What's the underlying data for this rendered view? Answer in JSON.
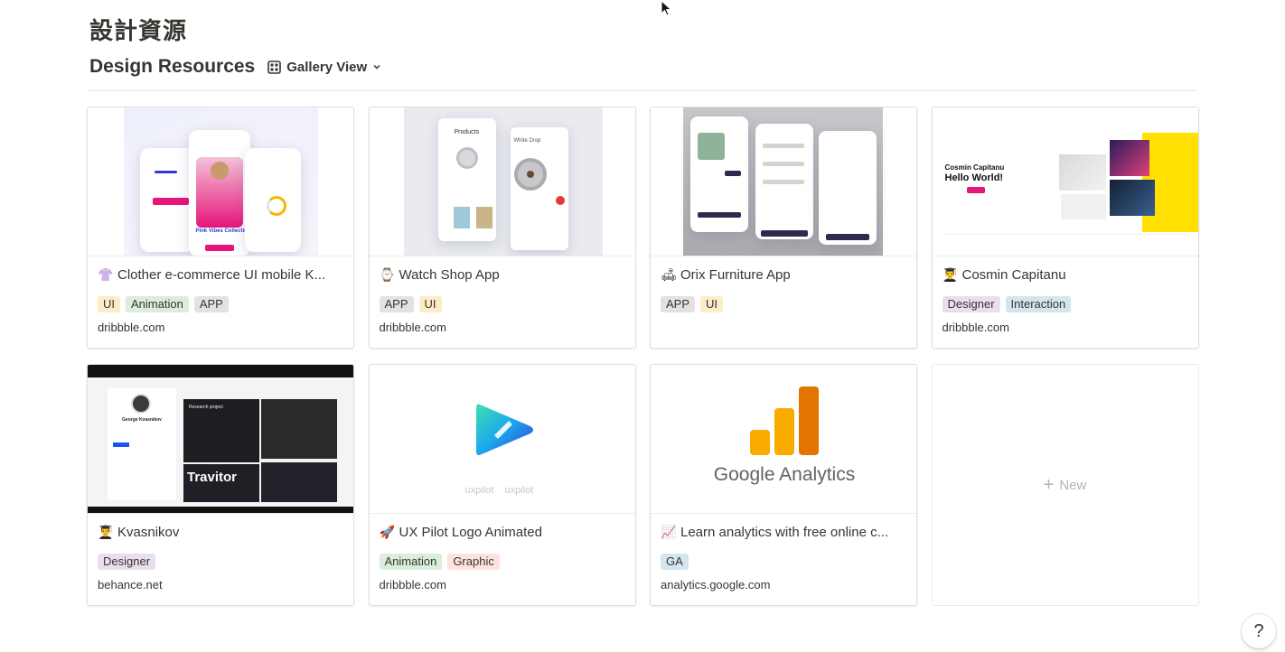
{
  "page": {
    "title": "設計資源"
  },
  "database": {
    "title": "Design Resources",
    "view_label": "Gallery View"
  },
  "colors": {
    "tag_ui": "#fdecc8",
    "tag_animation": "#dbeddb",
    "tag_app": "#e3e2e0",
    "tag_designer": "#e8deee",
    "tag_interaction": "#d3e5ef",
    "tag_graphic": "#ffe2dd",
    "tag_ga": "#d3e5ef",
    "accent_pink": "#e6157a",
    "ga_orange": "#f57c00",
    "ga_yellow": "#ffc107"
  },
  "cards": [
    {
      "emoji": "👚",
      "icon": "blouse-icon",
      "title": "Clother e-commerce UI mobile K...",
      "tags": [
        "UI",
        "Animation",
        "APP"
      ],
      "url": "dribbble.com"
    },
    {
      "emoji": "⌚",
      "icon": "watch-icon",
      "title": "Watch Shop App",
      "tags": [
        "APP",
        "UI"
      ],
      "url": "dribbble.com"
    },
    {
      "emoji": "🛋",
      "icon": "couch-icon",
      "title": "Orix Furniture App",
      "tags": [
        "APP",
        "UI"
      ],
      "url": ""
    },
    {
      "emoji": "👨‍🎓",
      "icon": "graduate-icon",
      "title": "Cosmin Capitanu",
      "tags": [
        "Designer",
        "Interaction"
      ],
      "url": "dribbble.com"
    },
    {
      "emoji": "👨‍🎓",
      "icon": "graduate-icon",
      "title": "Kvasnikov",
      "tags": [
        "Designer"
      ],
      "url": "behance.net"
    },
    {
      "emoji": "🚀",
      "icon": "rocket-icon",
      "title": "UX Pilot Logo Animated",
      "tags": [
        "Animation",
        "Graphic"
      ],
      "url": "dribbble.com"
    },
    {
      "emoji": "📈",
      "icon": "chart-increasing-icon",
      "title": "Learn analytics with free online c...",
      "tags": [
        "GA"
      ],
      "url": "analytics.google.com"
    }
  ],
  "thumb_text": {
    "c1_caption": "Pink Vibes Collection",
    "c2_heading": "Products",
    "c2_product": "White Drop",
    "c4_name": "Cosmin Capitanu",
    "c4_hello": "Hello World!",
    "c5_name": "George Kvasnikov",
    "c5_project": "Research project",
    "c5_word": "Travitor",
    "c6_left": "uxpilot",
    "c6_right": "uxpilot",
    "c7_logo": "Google Analytics"
  },
  "new_card": {
    "label": "New"
  },
  "help": {
    "label": "?"
  }
}
